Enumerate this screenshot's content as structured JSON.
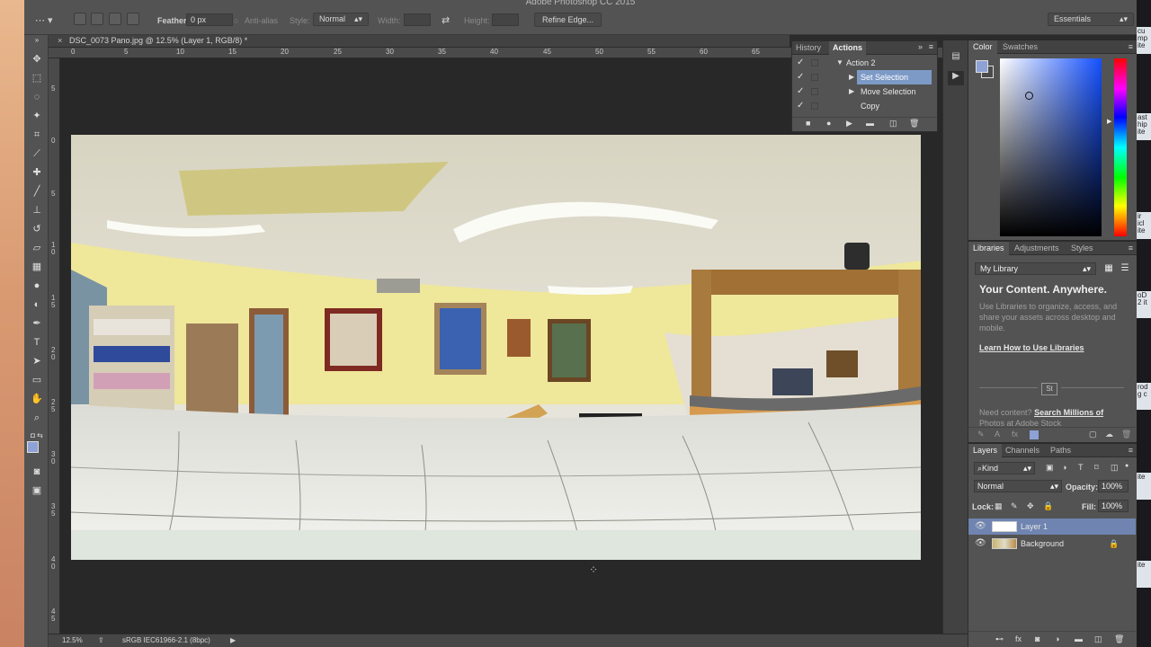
{
  "app": {
    "title": "Adobe Photoshop CC 2015",
    "workspace": "Essentials"
  },
  "options_bar": {
    "feather_label": "Feather:",
    "feather_value": "0 px",
    "antialias_label": "Anti-alias",
    "style_label": "Style:",
    "style_value": "Normal",
    "width_label": "Width:",
    "height_label": "Height:",
    "refine_edge": "Refine Edge..."
  },
  "document": {
    "tab_title": "DSC_0073 Pano.jpg @ 12.5% (Layer 1, RGB/8) *",
    "close_glyph": "×",
    "ruler_top": [
      "0",
      "5",
      "10",
      "15",
      "20",
      "25",
      "30",
      "35",
      "40",
      "45",
      "50",
      "55",
      "60",
      "65"
    ],
    "ruler_left": [
      "5",
      "0",
      "5",
      "1",
      "0",
      "1",
      "5",
      "2",
      "0",
      "2",
      "5",
      "3",
      "0",
      "3",
      "5",
      "4",
      "0",
      "4",
      "5"
    ]
  },
  "status_bar": {
    "zoom": "12.5%",
    "profile": "sRGB IEC61966-2.1 (8bpc)"
  },
  "actions_panel": {
    "tabs": [
      "History",
      "Actions"
    ],
    "active_tab": "Actions",
    "rows": [
      {
        "label": "Action 2"
      },
      {
        "label": "Set Selection"
      },
      {
        "label": "Move Selection"
      },
      {
        "label": "Copy"
      }
    ]
  },
  "color_panel": {
    "tabs": [
      "Color",
      "Swatches"
    ],
    "foreground": "#8ea2d6"
  },
  "libraries_panel": {
    "tabs": [
      "Libraries",
      "Adjustments",
      "Styles"
    ],
    "library": "My Library",
    "heading": "Your Content. Anywhere.",
    "description": "Use Libraries to organize, access, and share your assets across desktop and mobile.",
    "link": "Learn How to Use Libraries",
    "stock_badge": "St",
    "need_content": "Need content?",
    "search_link": "Search Millions of",
    "photos_text": "Photos at Adobe Stock"
  },
  "layers_panel": {
    "tabs": [
      "Layers",
      "Channels",
      "Paths"
    ],
    "kind": "Kind",
    "blend_mode": "Normal",
    "opacity_label": "Opacity:",
    "opacity": "100%",
    "lock_label": "Lock:",
    "fill_label": "Fill:",
    "fill": "100%",
    "layers": [
      {
        "name": "Layer 1",
        "selected": true
      },
      {
        "name": "Background",
        "selected": false
      }
    ]
  },
  "desktop_items": [
    "cu",
    "mp",
    "ite",
    "ast",
    "hip",
    "ite",
    "ir",
    "icl",
    "ite",
    "oD",
    "2 it",
    "rod",
    "g c",
    "ite",
    "ite"
  ],
  "colors": {
    "panel_bg": "#535353",
    "canvas_bg": "#282828",
    "selection": "#6f84b0"
  }
}
